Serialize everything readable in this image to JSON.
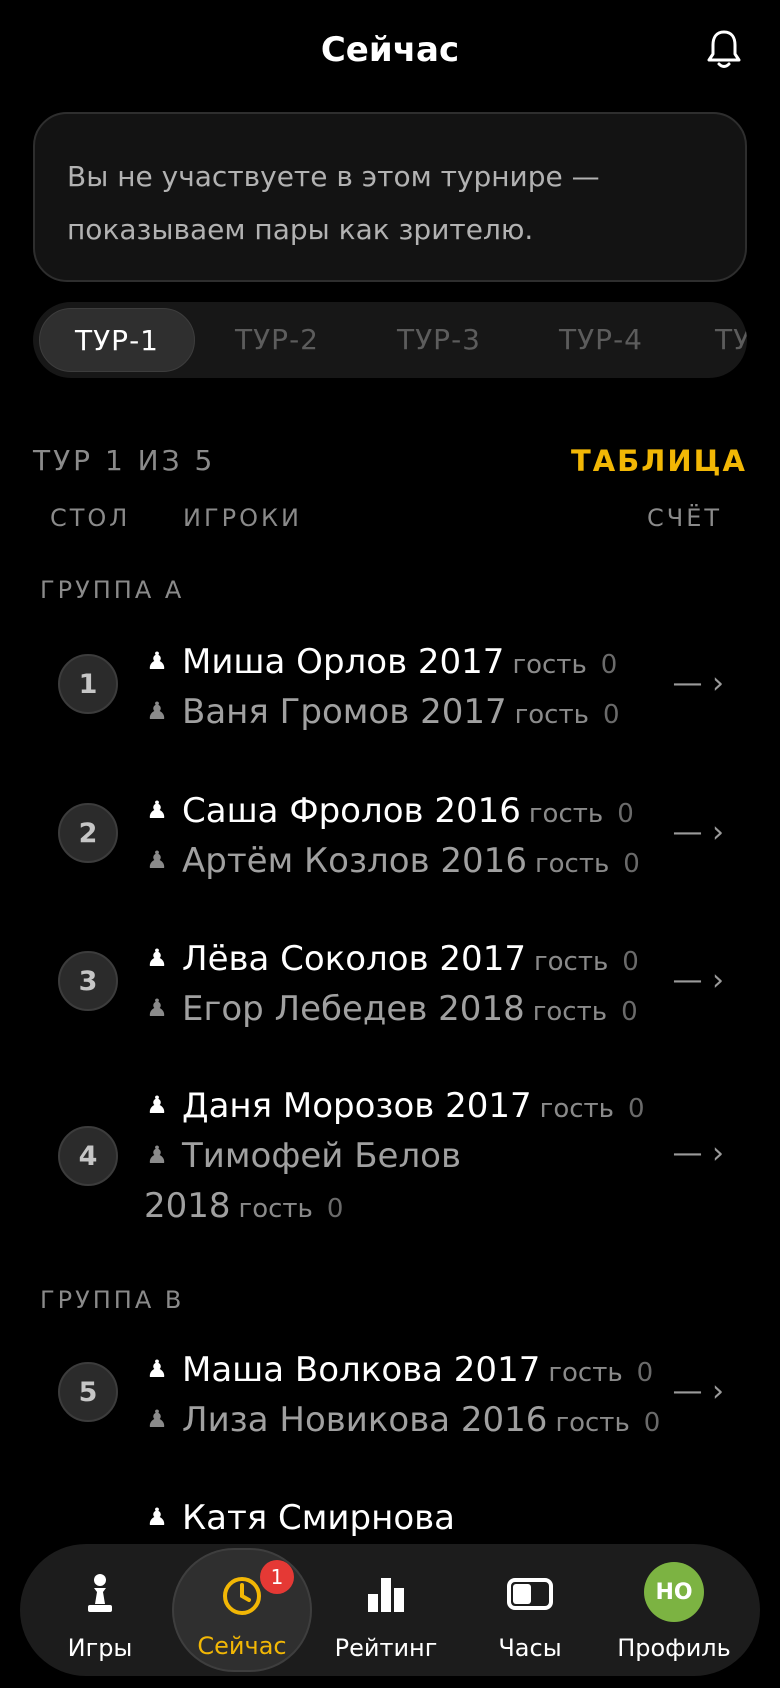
{
  "header": {
    "title": "Сейчас",
    "bell_icon": "bell-icon"
  },
  "notice": {
    "text": "Вы не участвуете в этом турнире — показываем пары как зрителю."
  },
  "tabs": [
    {
      "label": "ТУР-1",
      "active": true
    },
    {
      "label": "ТУР-2"
    },
    {
      "label": "ТУР-3"
    },
    {
      "label": "ТУР-4"
    },
    {
      "label": "ТУ"
    }
  ],
  "round": {
    "info": "ТУР 1 ИЗ 5",
    "table_link": "ТАБЛИЦА"
  },
  "columns": {
    "board": "СТОЛ",
    "players": "ИГРОКИ",
    "score": "СЧЁТ"
  },
  "groups": {
    "a": "ГРУППА А",
    "b": "ГРУППА В"
  },
  "pairs": [
    {
      "board": "1",
      "white": {
        "name": "Миша Орлов 2017",
        "tag": "гость",
        "pts": "0"
      },
      "black": {
        "name": "Ваня Громов 2017",
        "tag": "гость",
        "pts": "0"
      },
      "score": "— ›"
    },
    {
      "board": "2",
      "white": {
        "name": "Саша Фролов 2016",
        "tag": "гость",
        "pts": "0"
      },
      "black": {
        "name": "Артём Козлов 2016",
        "tag": "гость",
        "pts": "0"
      },
      "score": "— ›"
    },
    {
      "board": "3",
      "white": {
        "name": "Лёва Соколов 2017",
        "tag": "гость",
        "pts": "0"
      },
      "black": {
        "name": "Егор Лебедев 2018",
        "tag": "гость",
        "pts": "0"
      },
      "score": "— ›"
    },
    {
      "board": "4",
      "white": {
        "name": "Даня Морозов 2017",
        "tag": "гость",
        "pts": "0"
      },
      "black": {
        "name": "Тимофей Белов",
        "name2": "2018",
        "tag": "гость",
        "pts": "0"
      },
      "score": "— ›"
    },
    {
      "board": "5",
      "white": {
        "name": "Маша Волкова 2017",
        "tag": "гость",
        "pts": "0"
      },
      "black": {
        "name": "Лиза Новикова 2016",
        "tag": "гость",
        "pts": "0"
      },
      "score": "— ›"
    },
    {
      "white": {
        "name": "Катя Смирнова"
      }
    }
  ],
  "nav": [
    {
      "label": "Игры",
      "icon": "pawn-icon"
    },
    {
      "label": "Сейчас",
      "icon": "clock-icon",
      "badge": "1",
      "active": true
    },
    {
      "label": "Рейтинг",
      "icon": "bar-chart-icon"
    },
    {
      "label": "Часы",
      "icon": "chess-clock-icon"
    },
    {
      "label": "Профиль",
      "icon": "avatar",
      "avatar_text": "НО"
    }
  ],
  "colors": {
    "accent": "#f2b705",
    "badge": "#e53935",
    "avatar": "#7cb342"
  }
}
